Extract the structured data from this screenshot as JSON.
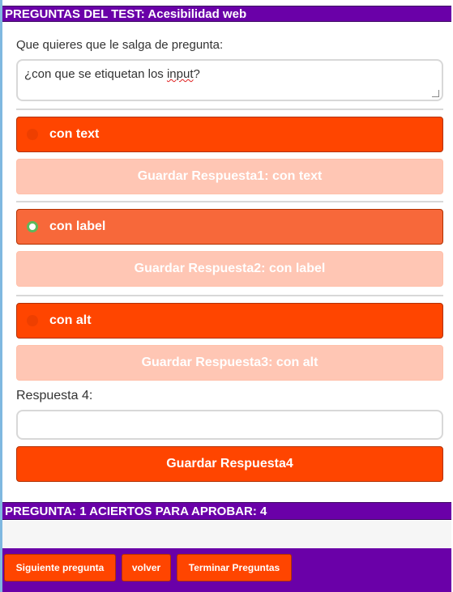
{
  "header": {
    "title": "PREGUNTAS DEL TEST: Acesibilidad web"
  },
  "question": {
    "prompt_label": "Que quieres que le salga de pregunta:",
    "text_before": "¿con que se etiquetan los ",
    "text_misspelled": "input",
    "text_after": "?"
  },
  "answers": [
    {
      "label": "con text",
      "selected": false,
      "save_label": "Guardar Respuesta1: con text"
    },
    {
      "label": "con label",
      "selected": true,
      "save_label": "Guardar Respuesta2: con label"
    },
    {
      "label": "con alt",
      "selected": false,
      "save_label": "Guardar Respuesta3: con alt"
    }
  ],
  "response4": {
    "label": "Respuesta 4:",
    "value": "",
    "save_label": "Guardar Respuesta4"
  },
  "status": {
    "text": "PREGUNTA: 1 ACIERTOS PARA APROBAR: 4"
  },
  "footer": {
    "next_label": "Siguiente pregunta",
    "back_label": "volver",
    "finish_label": "Terminar Preguntas"
  },
  "colors": {
    "purple": "#6a00a8",
    "orange": "#ff4500",
    "selected_orange": "#f7683a",
    "disabled_orange": "#ffc6b4",
    "radio_green": "#5cb85c"
  }
}
